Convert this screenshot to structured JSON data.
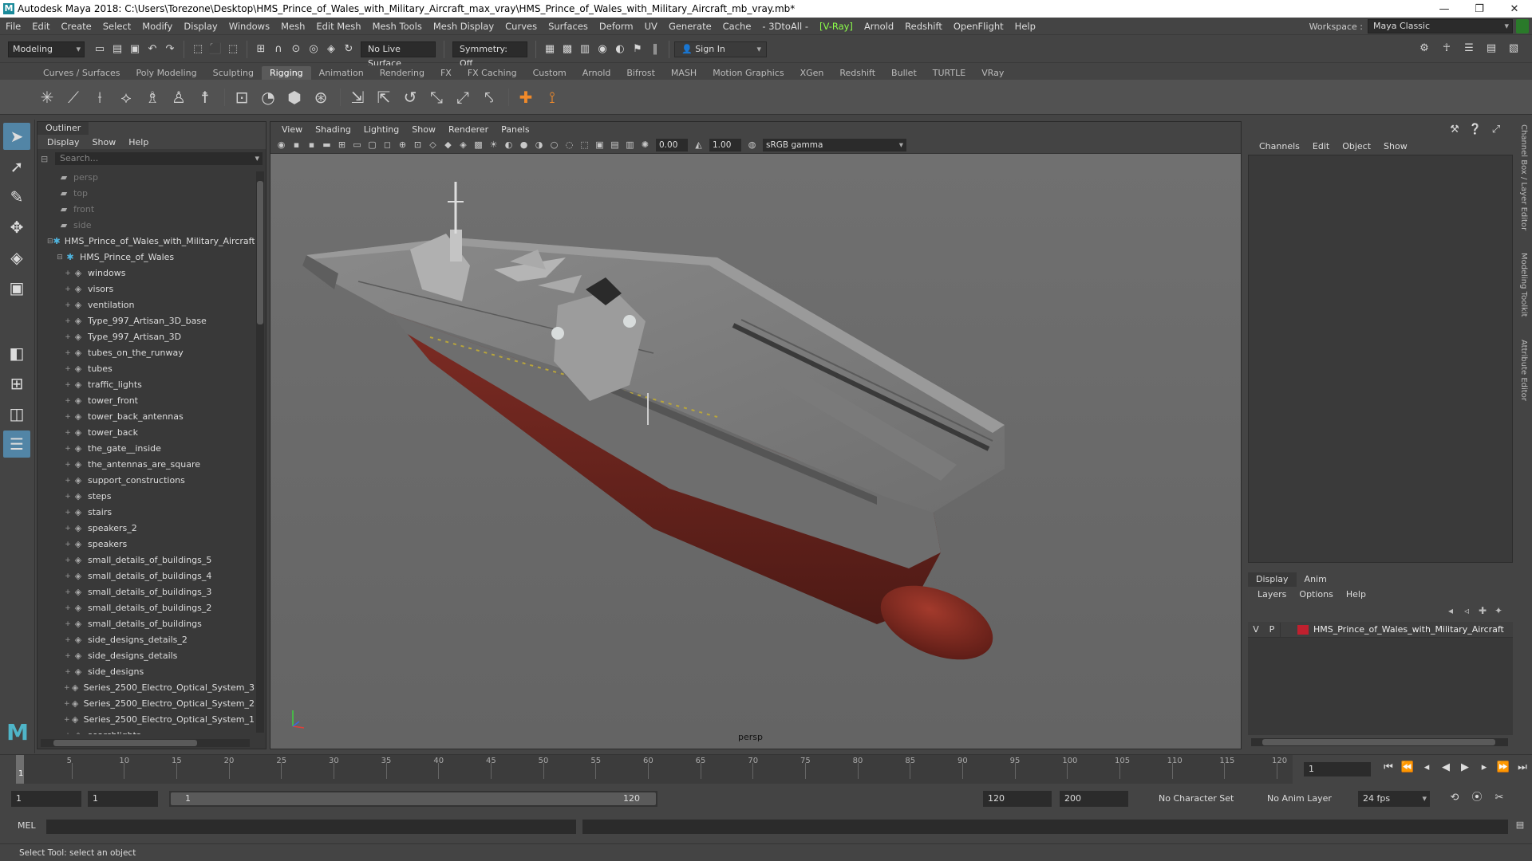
{
  "titlebar": {
    "title": "Autodesk Maya 2018: C:\\Users\\Torezone\\Desktop\\HMS_Prince_of_Wales_with_Military_Aircraft_max_vray\\HMS_Prince_of_Wales_with_Military_Aircraft_mb_vray.mb*",
    "minimize": "—",
    "restore": "❐",
    "close": "✕"
  },
  "menubar": {
    "items": [
      "File",
      "Edit",
      "Create",
      "Select",
      "Modify",
      "Display",
      "Windows",
      "Mesh",
      "Edit Mesh",
      "Mesh Tools",
      "Mesh Display",
      "Curves",
      "Surfaces",
      "Deform",
      "UV",
      "Generate",
      "Cache",
      "- 3DtoAll -",
      "[V-Ray]",
      "Arnold",
      "Redshift",
      "OpenFlight",
      "Help"
    ],
    "workspace_label": "Workspace :",
    "workspace_value": "Maya Classic"
  },
  "statusline": {
    "mode": "Modeling",
    "live_surface": "No Live Surface",
    "symmetry": "Symmetry: Off",
    "sign_in": "Sign In"
  },
  "shelf": {
    "tabs": [
      "Curves / Surfaces",
      "Poly Modeling",
      "Sculpting",
      "Rigging",
      "Animation",
      "Rendering",
      "FX",
      "FX Caching",
      "Custom",
      "Arnold",
      "Bifrost",
      "MASH",
      "Motion Graphics",
      "XGen",
      "Redshift",
      "Bullet",
      "TURTLE",
      "VRay"
    ],
    "active_tab": "Rigging"
  },
  "outliner": {
    "title": "Outliner",
    "menu": [
      "Display",
      "Show",
      "Help"
    ],
    "search_placeholder": "Search...",
    "items": [
      {
        "label": "persp",
        "type": "camera",
        "depth": 0
      },
      {
        "label": "top",
        "type": "camera",
        "depth": 0
      },
      {
        "label": "front",
        "type": "camera",
        "depth": 0
      },
      {
        "label": "side",
        "type": "camera",
        "depth": 0
      },
      {
        "label": "HMS_Prince_of_Wales_with_Military_Aircraft",
        "type": "group",
        "depth": 0
      },
      {
        "label": "HMS_Prince_of_Wales",
        "type": "group",
        "depth": 1
      },
      {
        "label": "windows",
        "type": "mesh",
        "depth": 2
      },
      {
        "label": "visors",
        "type": "mesh",
        "depth": 2
      },
      {
        "label": "ventilation",
        "type": "mesh",
        "depth": 2
      },
      {
        "label": "Type_997_Artisan_3D_base",
        "type": "mesh",
        "depth": 2
      },
      {
        "label": "Type_997_Artisan_3D",
        "type": "mesh",
        "depth": 2
      },
      {
        "label": "tubes_on_the_runway",
        "type": "mesh",
        "depth": 2
      },
      {
        "label": "tubes",
        "type": "mesh",
        "depth": 2
      },
      {
        "label": "traffic_lights",
        "type": "mesh",
        "depth": 2
      },
      {
        "label": "tower_front",
        "type": "mesh",
        "depth": 2
      },
      {
        "label": "tower_back_antennas",
        "type": "mesh",
        "depth": 2
      },
      {
        "label": "tower_back",
        "type": "mesh",
        "depth": 2
      },
      {
        "label": "the_gate__inside",
        "type": "mesh",
        "depth": 2
      },
      {
        "label": "the_antennas_are_square",
        "type": "mesh",
        "depth": 2
      },
      {
        "label": "support_constructions",
        "type": "mesh",
        "depth": 2
      },
      {
        "label": "steps",
        "type": "mesh",
        "depth": 2
      },
      {
        "label": "stairs",
        "type": "mesh",
        "depth": 2
      },
      {
        "label": "speakers_2",
        "type": "mesh",
        "depth": 2
      },
      {
        "label": "speakers",
        "type": "mesh",
        "depth": 2
      },
      {
        "label": "small_details_of_buildings_5",
        "type": "mesh",
        "depth": 2
      },
      {
        "label": "small_details_of_buildings_4",
        "type": "mesh",
        "depth": 2
      },
      {
        "label": "small_details_of_buildings_3",
        "type": "mesh",
        "depth": 2
      },
      {
        "label": "small_details_of_buildings_2",
        "type": "mesh",
        "depth": 2
      },
      {
        "label": "small_details_of_buildings",
        "type": "mesh",
        "depth": 2
      },
      {
        "label": "side_designs_details_2",
        "type": "mesh",
        "depth": 2
      },
      {
        "label": "side_designs_details",
        "type": "mesh",
        "depth": 2
      },
      {
        "label": "side_designs",
        "type": "mesh",
        "depth": 2
      },
      {
        "label": "Series_2500_Electro_Optical_System_3",
        "type": "mesh",
        "depth": 2
      },
      {
        "label": "Series_2500_Electro_Optical_System_2",
        "type": "mesh",
        "depth": 2
      },
      {
        "label": "Series_2500_Electro_Optical_System_1",
        "type": "mesh",
        "depth": 2
      },
      {
        "label": "searchlights",
        "type": "mesh",
        "depth": 2
      }
    ]
  },
  "viewport": {
    "menu": [
      "View",
      "Shading",
      "Lighting",
      "Show",
      "Renderer",
      "Panels"
    ],
    "exposure": "0.00",
    "gamma_value": "1.00",
    "color_space": "sRGB gamma",
    "camera_label": "persp"
  },
  "channelbox": {
    "menu": [
      "Channels",
      "Edit",
      "Object",
      "Show"
    ],
    "side_tabs": [
      "Channel Box / Layer Editor",
      "Modeling Toolkit",
      "Attribute Editor"
    ]
  },
  "layers": {
    "tabs": [
      "Display",
      "Anim"
    ],
    "menu": [
      "Layers",
      "Options",
      "Help"
    ],
    "row": {
      "v": "V",
      "p": "P",
      "name": "HMS_Prince_of_Wales_with_Military_Aircraft",
      "color": "#c0202e"
    }
  },
  "timeslider": {
    "ticks": [
      "5",
      "10",
      "15",
      "20",
      "25",
      "30",
      "35",
      "40",
      "45",
      "50",
      "55",
      "60",
      "65",
      "70",
      "75",
      "80",
      "85",
      "90",
      "95",
      "100",
      "105",
      "110",
      "115",
      "120"
    ],
    "start_tick": "1",
    "current_frame": "1"
  },
  "rangeslider": {
    "start": "1",
    "anim_start": "1",
    "range_left": "1",
    "range_right": "120",
    "end": "120",
    "anim_end": "200",
    "character_set": "No Character Set",
    "anim_layer": "No Anim Layer",
    "fps": "24 fps"
  },
  "cmdline": {
    "label": "MEL"
  },
  "helpline": {
    "text": "Select Tool: select an object"
  },
  "colors": {
    "accent": "#5285a6",
    "hull_red": "#8a2a24",
    "layer_red": "#c0202e",
    "maya_logo": "#4fb5c8"
  }
}
